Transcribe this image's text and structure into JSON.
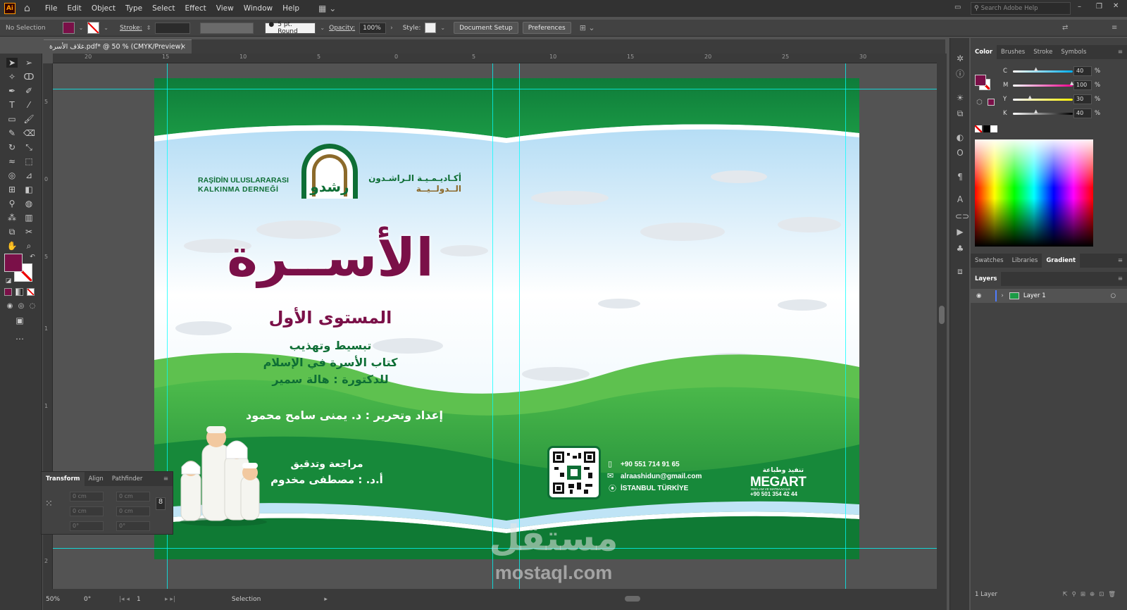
{
  "app": {
    "name": "Adobe Illustrator",
    "logo": "Ai"
  },
  "menu": [
    "File",
    "Edit",
    "Object",
    "Type",
    "Select",
    "Effect",
    "View",
    "Window",
    "Help"
  ],
  "search": {
    "placeholder": "Search Adobe Help"
  },
  "control_bar": {
    "selection": "No Selection",
    "stroke_label": "Stroke:",
    "brush": "5 pt. Round",
    "opacity_label": "Opacity:",
    "opacity_value": "100%",
    "style_label": "Style:",
    "doc_setup": "Document Setup",
    "preferences": "Preferences",
    "fill_color": "#7a1048"
  },
  "document": {
    "tab_title": "غلاف الأسرة.pdf* @ 50 % (CMYK/Preview)"
  },
  "rulers": {
    "h": [
      "20",
      "15",
      "10",
      "5",
      "0",
      "5",
      "10",
      "15",
      "20",
      "25",
      "30"
    ],
    "v": [
      "5",
      "0",
      "5",
      "1",
      "1",
      "1",
      "2"
    ]
  },
  "cover": {
    "org_tr_line1": "RAŞİDİN ULUSLARARASI",
    "org_tr_line2": "KALKINMA DERNEĞİ",
    "org_ar_line1": "أكـاديـمـيـة الـراشـدون",
    "org_ar_line2": "الــدولــيــة",
    "logo_text": "رشدو",
    "title": "الأســرة",
    "level": "المستوى الأول",
    "line1": "تبسيط وتهذيب",
    "line2": "كتاب الأسرة في الإسلام",
    "line3": "للدكتورة : هالة سمير",
    "editor": "إعداد وتحرير : د. يمنى سامح محمود",
    "review_label": "مراجعة وتدقيق",
    "reviewer": "أ.د. : مصطفى مخدوم",
    "phone": "+90 551 714 91 65",
    "email": "alraashidun@gmail.com",
    "location": "İSTANBUL TÜRKİYE",
    "printer_ar": "تنفيذ وطباعة",
    "printer_name": "MEGART",
    "printer_sub": "REKLAM VE MATBAACILIK",
    "printer_phone": "+90 501 354 42 44"
  },
  "watermark": {
    "arabic": "مستقل",
    "latin": "mostaql.com"
  },
  "status": {
    "zoom": "50%",
    "rotate": "0°",
    "artboard": "1",
    "tool": "Selection"
  },
  "transform_panel": {
    "tabs": [
      "Transform",
      "Align",
      "Pathfinder"
    ],
    "x": "0 cm",
    "y": "0 cm",
    "w": "0 cm",
    "h": "0 cm",
    "angle": "0°",
    "shear": "0°"
  },
  "color_panel": {
    "tabs": [
      "Color",
      "Brushes",
      "Stroke",
      "Symbols"
    ],
    "channels": [
      {
        "name": "C",
        "value": "40",
        "pct": 40,
        "color": "#00aeef"
      },
      {
        "name": "M",
        "value": "100",
        "pct": 100,
        "color": "#ec008c"
      },
      {
        "name": "Y",
        "value": "30",
        "pct": 30,
        "color": "#fff200"
      },
      {
        "name": "K",
        "value": "40",
        "pct": 40,
        "color": "#000000"
      }
    ],
    "unit": "%"
  },
  "lib_tabs": [
    "Swatches",
    "Libraries",
    "Gradient"
  ],
  "layers_panel": {
    "title": "Layers",
    "layer": "Layer 1",
    "count": "1 Layer"
  }
}
